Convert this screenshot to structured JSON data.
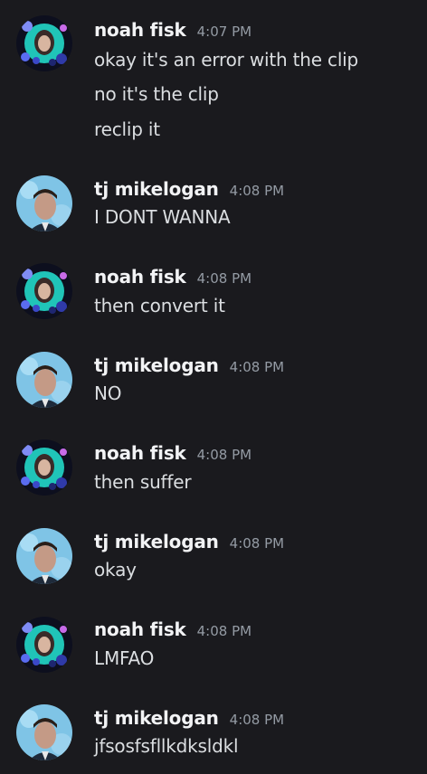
{
  "messages": [
    {
      "author": "noah fisk",
      "time": "4:07 PM",
      "avatar": "noah-avatar",
      "lines": [
        "okay it's an error with the clip",
        "no it's the clip",
        "reclip it"
      ]
    },
    {
      "author": "tj mikelogan",
      "time": "4:08 PM",
      "avatar": "tj-avatar",
      "lines": [
        "I DONT WANNA"
      ]
    },
    {
      "author": "noah fisk",
      "time": "4:08 PM",
      "avatar": "noah-avatar",
      "lines": [
        "then convert it"
      ]
    },
    {
      "author": "tj mikelogan",
      "time": "4:08 PM",
      "avatar": "tj-avatar",
      "lines": [
        "NO"
      ]
    },
    {
      "author": "noah fisk",
      "time": "4:08 PM",
      "avatar": "noah-avatar",
      "lines": [
        "then suffer"
      ]
    },
    {
      "author": "tj mikelogan",
      "time": "4:08 PM",
      "avatar": "tj-avatar",
      "lines": [
        "okay"
      ]
    },
    {
      "author": "noah fisk",
      "time": "4:08 PM",
      "avatar": "noah-avatar",
      "lines": [
        "LMFAO"
      ]
    },
    {
      "author": "tj mikelogan",
      "time": "4:08 PM",
      "avatar": "tj-avatar",
      "lines": [
        "jfsosfsfllkdksldkl"
      ]
    }
  ]
}
